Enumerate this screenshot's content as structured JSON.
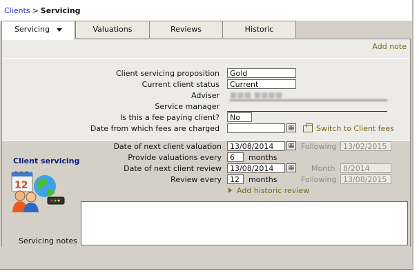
{
  "breadcrumb": {
    "parent": "Clients",
    "separator": ">",
    "current": "Servicing"
  },
  "tabs": [
    {
      "label": "Servicing",
      "active": true
    },
    {
      "label": "Valuations",
      "active": false
    },
    {
      "label": "Reviews",
      "active": false
    },
    {
      "label": "Historic",
      "active": false
    }
  ],
  "add_note": "Add note",
  "client": {
    "proposition_label": "Client servicing proposition",
    "proposition_value": "Gold",
    "status_label": "Current client status",
    "status_value": "Current",
    "adviser_label": "Adviser",
    "adviser_value": "■■■  ■■■■",
    "service_manager_label": "Service manager",
    "service_manager_value": "",
    "fee_paying_label": "Is this a fee paying client?",
    "fee_paying_value": "No",
    "fees_date_label": "Date from which fees are charged",
    "fees_date_value": "",
    "switch_label": "Switch to Client fees"
  },
  "servicing": {
    "section_title": "Client servicing",
    "next_valuation_label": "Date of next client valuation",
    "next_valuation_value": "13/08/2014",
    "following_label_1": "Following",
    "following_value_1": "13/02/2015",
    "valuations_every_label": "Provide valuations every",
    "valuations_every_value": "6",
    "months_label_1": "months",
    "next_review_label": "Date of next client review",
    "next_review_value": "13/08/2014",
    "month_label": "Month",
    "month_value": "8/2014",
    "review_every_label": "Review every",
    "review_every_value": "12",
    "months_label_2": "months",
    "following_label_2": "Following",
    "following_value_2": "13/08/2015",
    "add_historic_review": "Add historic review",
    "notes_label": "Servicing notes",
    "notes_value": ""
  },
  "colors": {
    "link_blue": "#1a2fc5",
    "olive_link": "#7a6a1c",
    "section_title": "#0b1f80"
  },
  "icons": [
    "calendar-icon",
    "switch-icon",
    "arrow-right-icon",
    "client-servicing-icon"
  ]
}
